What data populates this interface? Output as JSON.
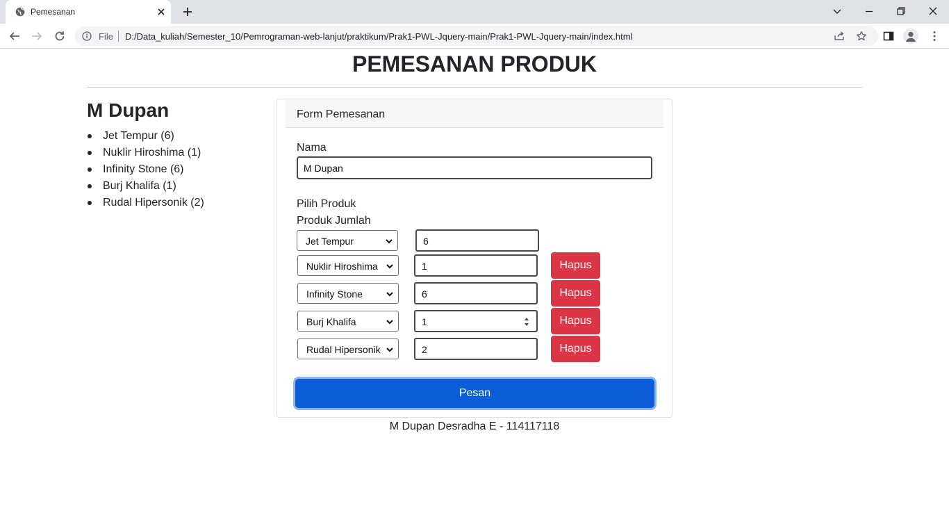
{
  "browser": {
    "tab_title": "Pemesanan",
    "file_label": "File",
    "url": "D:/Data_kuliah/Semester_10/Pemrograman-web-lanjut/praktikum/Prak1-PWL-Jquery-main/Prak1-PWL-Jquery-main/index.html"
  },
  "page": {
    "title": "PEMESANAN PRODUK"
  },
  "summary": {
    "name": "M Dupan",
    "items": [
      "Jet Tempur (6)",
      "Nuklir Hiroshima (1)",
      "Infinity Stone (6)",
      "Burj Khalifa (1)",
      "Rudal Hipersonik (2)"
    ]
  },
  "form": {
    "header": "Form Pemesanan",
    "nama_label": "Nama",
    "nama_value": "M Dupan",
    "pilih_produk_label": "Pilih Produk",
    "columns_label": "Produk Jumlah",
    "rows": [
      {
        "product": "Jet Tempur",
        "qty": "6"
      },
      {
        "product": "Nuklir Hiroshima",
        "qty": "1",
        "remove_label": "Hapus"
      },
      {
        "product": "Infinity Stone",
        "qty": "6",
        "remove_label": "Hapus"
      },
      {
        "product": "Burj Khalifa",
        "qty": "1",
        "remove_label": "Hapus"
      },
      {
        "product": "Rudal Hipersonik",
        "qty": "2",
        "remove_label": "Hapus"
      }
    ],
    "submit_label": "Pesan"
  },
  "footer": {
    "text": "M Dupan Desradha E - 114117118"
  },
  "colors": {
    "primary": "#0b5ed7",
    "danger": "#dc3545"
  }
}
